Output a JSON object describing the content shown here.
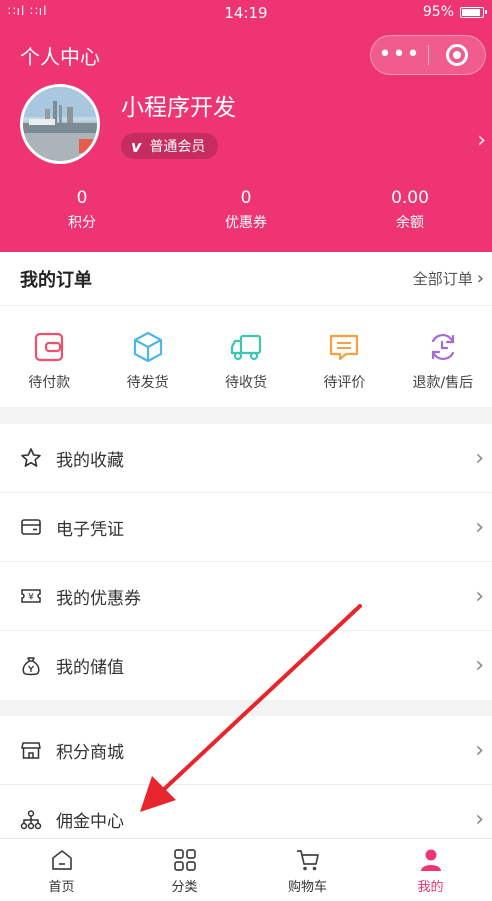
{
  "status_bar": {
    "signal": "∷ıl ∷ıl",
    "time": "14:19",
    "battery": "95%"
  },
  "nav": {
    "title": "个人中心"
  },
  "profile": {
    "username": "小程序开发",
    "member_badge_icon": "v",
    "member_badge": "普通会员"
  },
  "stats": [
    {
      "value": "0",
      "label": "积分"
    },
    {
      "value": "0",
      "label": "优惠券"
    },
    {
      "value": "0.00",
      "label": "余额"
    }
  ],
  "orders": {
    "title": "我的订单",
    "all_label": "全部订单",
    "items": [
      {
        "label": "待付款",
        "icon": "wallet-icon",
        "color": "#f0506e"
      },
      {
        "label": "待发货",
        "icon": "box-icon",
        "color": "#4fb7e8"
      },
      {
        "label": "待收货",
        "icon": "truck-icon",
        "color": "#3cc7b4"
      },
      {
        "label": "待评价",
        "icon": "comment-icon",
        "color": "#f5a142"
      },
      {
        "label": "退款/售后",
        "icon": "refund-icon",
        "color": "#a66bd8"
      }
    ]
  },
  "menu_group_1": [
    {
      "label": "我的收藏",
      "icon": "star-icon"
    },
    {
      "label": "电子凭证",
      "icon": "card-icon"
    },
    {
      "label": "我的优惠券",
      "icon": "coupon-icon"
    },
    {
      "label": "我的储值",
      "icon": "moneybag-icon"
    }
  ],
  "menu_group_2": [
    {
      "label": "积分商城",
      "icon": "store-icon"
    },
    {
      "label": "佣金中心",
      "icon": "network-icon"
    }
  ],
  "tabbar": [
    {
      "label": "首页",
      "icon": "home-icon"
    },
    {
      "label": "分类",
      "icon": "grid-icon"
    },
    {
      "label": "购物车",
      "icon": "cart-icon"
    },
    {
      "label": "我的",
      "icon": "user-icon",
      "active": true
    }
  ],
  "colors": {
    "brand": "#ee3472",
    "annotation": "#e8242c"
  }
}
